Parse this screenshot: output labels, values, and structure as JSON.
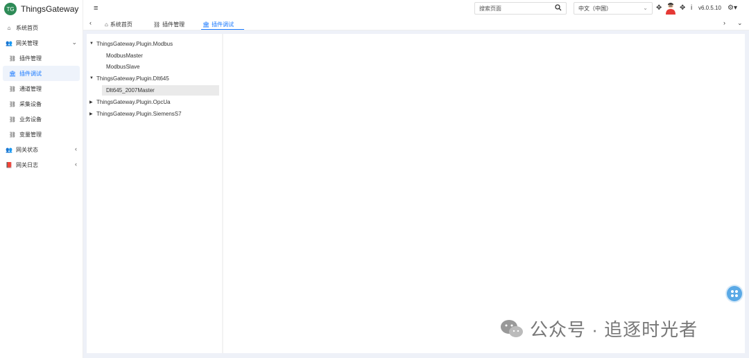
{
  "app": {
    "logo_badge": "TG",
    "title": "ThingsGateway"
  },
  "sidebar": {
    "items": [
      {
        "label": "系统首页",
        "icon": "home-icon"
      },
      {
        "label": "网关管理",
        "icon": "users-icon",
        "expanded": true
      },
      {
        "label": "插件管理",
        "icon": "nodes-icon"
      },
      {
        "label": "插件调试",
        "icon": "bank-icon",
        "active": true
      },
      {
        "label": "通道管理",
        "icon": "nodes-icon"
      },
      {
        "label": "采集设备",
        "icon": "nodes-icon"
      },
      {
        "label": "业务设备",
        "icon": "nodes-icon"
      },
      {
        "label": "变量管理",
        "icon": "nodes-icon"
      },
      {
        "label": "网关状态",
        "icon": "users-icon",
        "expanded": false
      },
      {
        "label": "网关日志",
        "icon": "book-icon",
        "expanded": false
      }
    ]
  },
  "header": {
    "search_placeholder": "搜索页面",
    "language": "中文（中国）",
    "version": "v6.0.5.10"
  },
  "tabs": [
    {
      "label": "系统首页",
      "icon": "home-icon"
    },
    {
      "label": "插件管理",
      "icon": "nodes-icon"
    },
    {
      "label": "插件调试",
      "icon": "bank-icon",
      "active": true
    }
  ],
  "tree": [
    {
      "label": "ThingsGateway.Plugin.Modbus",
      "level": 0,
      "expanded": true
    },
    {
      "label": "ModbusMaster",
      "level": 1
    },
    {
      "label": "ModbusSlave",
      "level": 1
    },
    {
      "label": "ThingsGateway.Plugin.Dlt645",
      "level": 0,
      "expanded": true
    },
    {
      "label": "Dlt645_2007Master",
      "level": 1,
      "selected": true
    },
    {
      "label": "ThingsGateway.Plugin.OpcUa",
      "level": 0,
      "expanded": false
    },
    {
      "label": "ThingsGateway.Plugin.SiemensS7",
      "level": 0,
      "expanded": false
    }
  ],
  "watermark": {
    "text": "公众号 · 追逐时光者"
  },
  "colors": {
    "accent": "#1677ff",
    "logo": "#2e8b57",
    "content_bg": "#eef1f8",
    "fab": "#5aa9e6"
  }
}
